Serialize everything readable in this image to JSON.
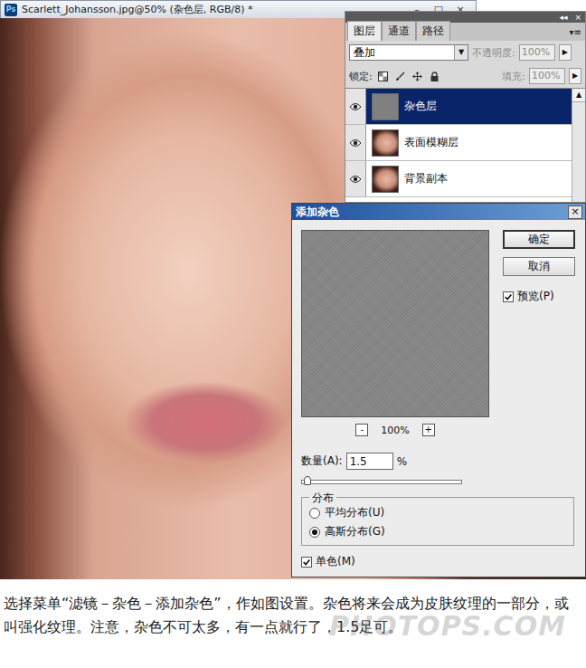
{
  "document": {
    "icon": "Ps",
    "title": "Scarlett_Johansson.jpg@50% (杂色层, RGB/8) *",
    "controls": [
      "–",
      "□",
      "×"
    ]
  },
  "layers_panel": {
    "header_buttons": [
      "◂◂",
      "×"
    ],
    "menu": "▾≡",
    "tabs": [
      {
        "label": "图层",
        "selected": true
      },
      {
        "label": "通道",
        "selected": false
      },
      {
        "label": "路径",
        "selected": false
      }
    ],
    "blend_mode": {
      "value": "叠加",
      "arrow": "▼"
    },
    "opacity": {
      "label": "不透明度:",
      "value": "100%",
      "arrow": "▶",
      "disabled": true
    },
    "lock_label": "锁定:",
    "fill": {
      "label": "填充:",
      "value": "100%",
      "arrow": "▶",
      "disabled": true
    },
    "scroll_up": "▲",
    "layers": [
      {
        "name": "杂色层",
        "visible": true,
        "selected": true,
        "kind": "solid"
      },
      {
        "name": "表面模糊层",
        "visible": true,
        "selected": false,
        "kind": "photo"
      },
      {
        "name": "背景副本",
        "visible": true,
        "selected": false,
        "kind": "photo"
      }
    ]
  },
  "dialog": {
    "title": "添加杂色",
    "close": "×",
    "buttons": [
      {
        "label": "确定",
        "default": true
      },
      {
        "label": "取消",
        "default": false
      }
    ],
    "preview": {
      "label": "预览(P)",
      "checked": true
    },
    "zoom": {
      "minus": "-",
      "value": "100%",
      "plus": "+"
    },
    "amount": {
      "label": "数量(A):",
      "value": "1.5",
      "unit": "%",
      "level": 0.015
    },
    "distribution": {
      "label": "分布",
      "options": [
        {
          "label": "平均分布(U)",
          "selected": false
        },
        {
          "label": "高斯分布(G)",
          "selected": true
        }
      ]
    },
    "monochromatic": {
      "label": "单色(M)",
      "checked": true
    }
  },
  "caption": "选择菜单“滤镜－杂色－添加杂色”，作如图设置。杂色将来会成为皮肤纹理的一部分，或叫强化纹理。注意，杂色不可太多，有一点就行了，1.5足可。",
  "watermark": "PHOTOPS.COM"
}
